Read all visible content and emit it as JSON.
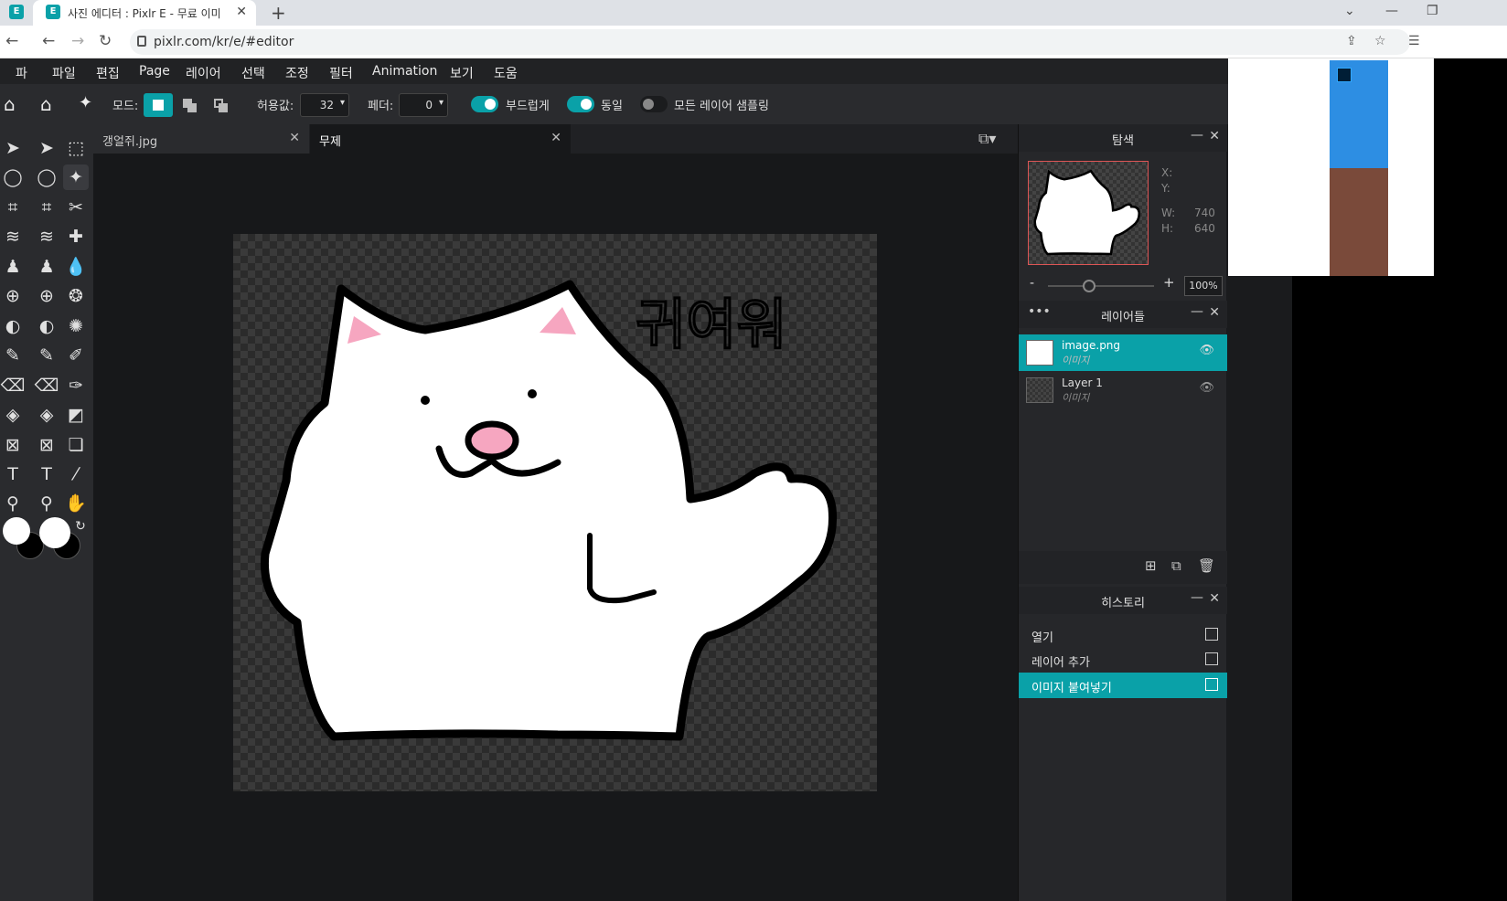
{
  "browser": {
    "tab_title": "사진 에디터 : Pixlr E - 무료 이미",
    "tab_icon_letter": "E",
    "url": "pixlr.com/kr/e/#editor"
  },
  "menu": [
    "파",
    "파일",
    "편집",
    "Page",
    "레이어",
    "선택",
    "조정",
    "필터",
    "Animation",
    "보기",
    "도움"
  ],
  "options": {
    "mode_label": "모드:",
    "tolerance_label": "허용값:",
    "tolerance_value": "32",
    "feather_label": "페더:",
    "feather_value": "0",
    "smooth_label": "부드럽게",
    "smooth_on": true,
    "contiguous_label": "동일",
    "contiguous_on": true,
    "sample_all_label": "모든 레이어 샘플링",
    "sample_all_on": false
  },
  "doc_tabs": [
    {
      "label": "갱얼쥐.jpg",
      "active": false
    },
    {
      "label": "무제",
      "active": true
    }
  ],
  "canvas_text": "귀여워",
  "navigator": {
    "title": "탐색",
    "x_label": "X:",
    "y_label": "Y:",
    "w_label": "W:",
    "w_value": "740",
    "h_label": "H:",
    "h_value": "640",
    "zoom": "100%",
    "zoom_minus": "-",
    "zoom_plus": "+"
  },
  "layers": {
    "title": "레이어들",
    "items": [
      {
        "name": "image.png",
        "type": "이미지",
        "selected": true
      },
      {
        "name": "Layer 1",
        "type": "이미지",
        "selected": false
      }
    ]
  },
  "history": {
    "title": "히스토리",
    "items": [
      {
        "label": "열기",
        "selected": false
      },
      {
        "label": "레이어 추가",
        "selected": false
      },
      {
        "label": "이미지 붙여넣기",
        "selected": true
      }
    ]
  },
  "colors": {
    "accent": "#0aa1a8",
    "panel": "#26272a",
    "canvas_bg": "#17181a"
  }
}
